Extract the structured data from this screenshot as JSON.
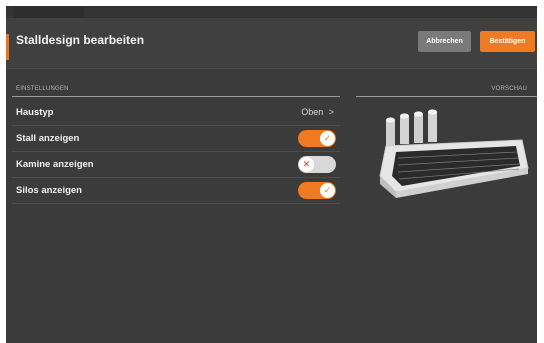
{
  "header": {
    "title": "Stalldesign bearbeiten",
    "cancel_label": "Abbrechen",
    "confirm_label": "Bestätigen"
  },
  "sections": {
    "settings": "EINSTELLUNGEN",
    "preview": "VORSCHAU"
  },
  "settings": {
    "haustyp": {
      "label": "Haustyp",
      "value": "Oben",
      "chevron": ">"
    },
    "stall": {
      "label": "Stall anzeigen",
      "on": true,
      "icon": "check-icon"
    },
    "kamine": {
      "label": "Kamine anzeigen",
      "on": false,
      "icon": "close-icon"
    },
    "silos": {
      "label": "Silos anzeigen",
      "on": true,
      "icon": "check-icon"
    }
  },
  "colors": {
    "accent": "#ee7a22",
    "background": "#3b3b3b",
    "cancel": "#7a7a7a"
  }
}
